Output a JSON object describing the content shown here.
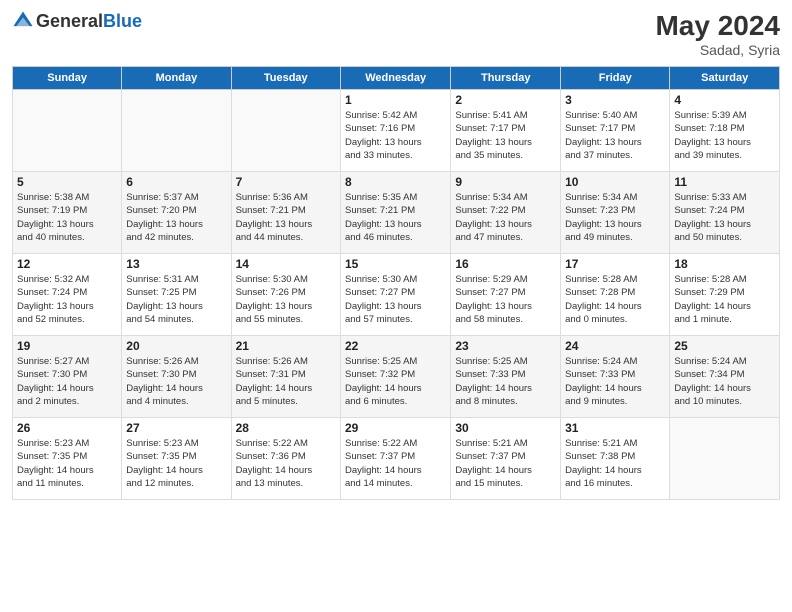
{
  "header": {
    "logo_general": "General",
    "logo_blue": "Blue",
    "month_year": "May 2024",
    "location": "Sadad, Syria"
  },
  "weekdays": [
    "Sunday",
    "Monday",
    "Tuesday",
    "Wednesday",
    "Thursday",
    "Friday",
    "Saturday"
  ],
  "weeks": [
    [
      {
        "day": "",
        "info": ""
      },
      {
        "day": "",
        "info": ""
      },
      {
        "day": "",
        "info": ""
      },
      {
        "day": "1",
        "info": "Sunrise: 5:42 AM\nSunset: 7:16 PM\nDaylight: 13 hours\nand 33 minutes."
      },
      {
        "day": "2",
        "info": "Sunrise: 5:41 AM\nSunset: 7:17 PM\nDaylight: 13 hours\nand 35 minutes."
      },
      {
        "day": "3",
        "info": "Sunrise: 5:40 AM\nSunset: 7:17 PM\nDaylight: 13 hours\nand 37 minutes."
      },
      {
        "day": "4",
        "info": "Sunrise: 5:39 AM\nSunset: 7:18 PM\nDaylight: 13 hours\nand 39 minutes."
      }
    ],
    [
      {
        "day": "5",
        "info": "Sunrise: 5:38 AM\nSunset: 7:19 PM\nDaylight: 13 hours\nand 40 minutes."
      },
      {
        "day": "6",
        "info": "Sunrise: 5:37 AM\nSunset: 7:20 PM\nDaylight: 13 hours\nand 42 minutes."
      },
      {
        "day": "7",
        "info": "Sunrise: 5:36 AM\nSunset: 7:21 PM\nDaylight: 13 hours\nand 44 minutes."
      },
      {
        "day": "8",
        "info": "Sunrise: 5:35 AM\nSunset: 7:21 PM\nDaylight: 13 hours\nand 46 minutes."
      },
      {
        "day": "9",
        "info": "Sunrise: 5:34 AM\nSunset: 7:22 PM\nDaylight: 13 hours\nand 47 minutes."
      },
      {
        "day": "10",
        "info": "Sunrise: 5:34 AM\nSunset: 7:23 PM\nDaylight: 13 hours\nand 49 minutes."
      },
      {
        "day": "11",
        "info": "Sunrise: 5:33 AM\nSunset: 7:24 PM\nDaylight: 13 hours\nand 50 minutes."
      }
    ],
    [
      {
        "day": "12",
        "info": "Sunrise: 5:32 AM\nSunset: 7:24 PM\nDaylight: 13 hours\nand 52 minutes."
      },
      {
        "day": "13",
        "info": "Sunrise: 5:31 AM\nSunset: 7:25 PM\nDaylight: 13 hours\nand 54 minutes."
      },
      {
        "day": "14",
        "info": "Sunrise: 5:30 AM\nSunset: 7:26 PM\nDaylight: 13 hours\nand 55 minutes."
      },
      {
        "day": "15",
        "info": "Sunrise: 5:30 AM\nSunset: 7:27 PM\nDaylight: 13 hours\nand 57 minutes."
      },
      {
        "day": "16",
        "info": "Sunrise: 5:29 AM\nSunset: 7:27 PM\nDaylight: 13 hours\nand 58 minutes."
      },
      {
        "day": "17",
        "info": "Sunrise: 5:28 AM\nSunset: 7:28 PM\nDaylight: 14 hours\nand 0 minutes."
      },
      {
        "day": "18",
        "info": "Sunrise: 5:28 AM\nSunset: 7:29 PM\nDaylight: 14 hours\nand 1 minute."
      }
    ],
    [
      {
        "day": "19",
        "info": "Sunrise: 5:27 AM\nSunset: 7:30 PM\nDaylight: 14 hours\nand 2 minutes."
      },
      {
        "day": "20",
        "info": "Sunrise: 5:26 AM\nSunset: 7:30 PM\nDaylight: 14 hours\nand 4 minutes."
      },
      {
        "day": "21",
        "info": "Sunrise: 5:26 AM\nSunset: 7:31 PM\nDaylight: 14 hours\nand 5 minutes."
      },
      {
        "day": "22",
        "info": "Sunrise: 5:25 AM\nSunset: 7:32 PM\nDaylight: 14 hours\nand 6 minutes."
      },
      {
        "day": "23",
        "info": "Sunrise: 5:25 AM\nSunset: 7:33 PM\nDaylight: 14 hours\nand 8 minutes."
      },
      {
        "day": "24",
        "info": "Sunrise: 5:24 AM\nSunset: 7:33 PM\nDaylight: 14 hours\nand 9 minutes."
      },
      {
        "day": "25",
        "info": "Sunrise: 5:24 AM\nSunset: 7:34 PM\nDaylight: 14 hours\nand 10 minutes."
      }
    ],
    [
      {
        "day": "26",
        "info": "Sunrise: 5:23 AM\nSunset: 7:35 PM\nDaylight: 14 hours\nand 11 minutes."
      },
      {
        "day": "27",
        "info": "Sunrise: 5:23 AM\nSunset: 7:35 PM\nDaylight: 14 hours\nand 12 minutes."
      },
      {
        "day": "28",
        "info": "Sunrise: 5:22 AM\nSunset: 7:36 PM\nDaylight: 14 hours\nand 13 minutes."
      },
      {
        "day": "29",
        "info": "Sunrise: 5:22 AM\nSunset: 7:37 PM\nDaylight: 14 hours\nand 14 minutes."
      },
      {
        "day": "30",
        "info": "Sunrise: 5:21 AM\nSunset: 7:37 PM\nDaylight: 14 hours\nand 15 minutes."
      },
      {
        "day": "31",
        "info": "Sunrise: 5:21 AM\nSunset: 7:38 PM\nDaylight: 14 hours\nand 16 minutes."
      },
      {
        "day": "",
        "info": ""
      }
    ]
  ]
}
